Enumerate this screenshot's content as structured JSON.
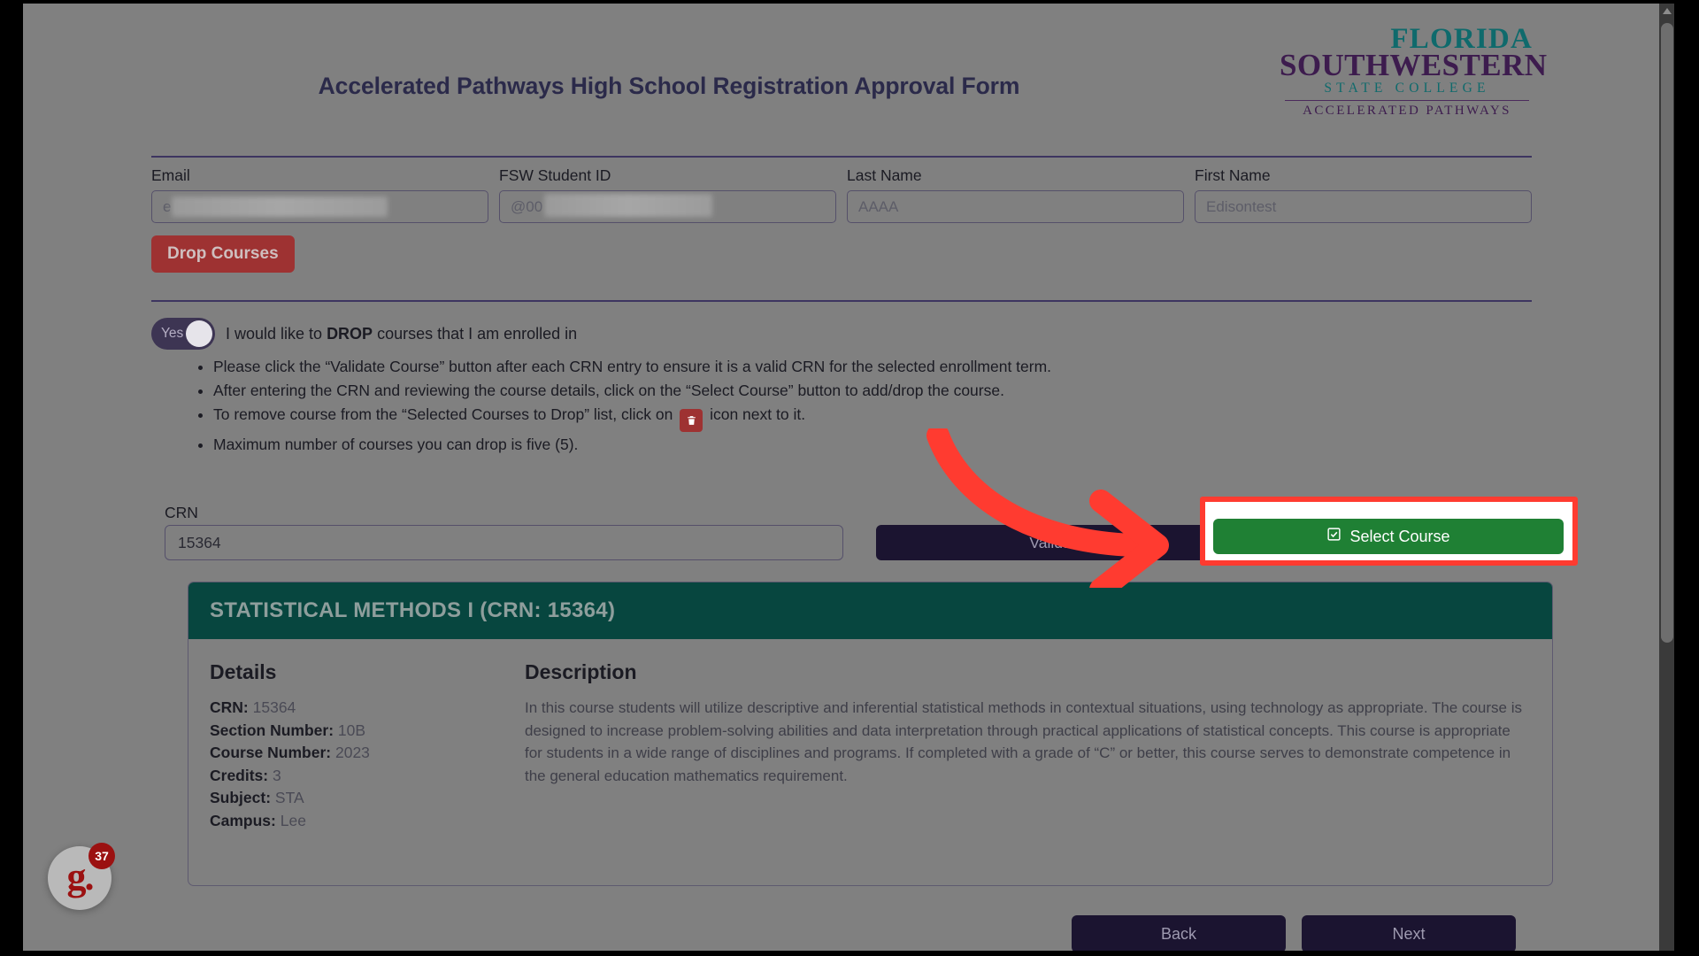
{
  "page": {
    "title": "Accelerated Pathways High School Registration Approval Form"
  },
  "logo": {
    "line1": "FLORIDA",
    "line2": "SOUTHWESTERN",
    "line3": "STATE COLLEGE",
    "line4": "ACCELERATED PATHWAYS",
    "teal": "#0f6a6c",
    "purple": "#3d1c4e"
  },
  "fields": [
    {
      "label": "Email",
      "value": "e",
      "redacted": true
    },
    {
      "label": "FSW Student ID",
      "value": "@00",
      "redacted": true
    },
    {
      "label": "Last Name",
      "value": "AAAA",
      "redacted": false
    },
    {
      "label": "First Name",
      "value": "Edisontest",
      "redacted": false
    }
  ],
  "section": {
    "drop_courses_label": "Drop Courses",
    "drop_courses_color": "#9e3232"
  },
  "toggle": {
    "state_label": "Yes",
    "description_prefix": "I would like to ",
    "description_emphasis": "DROP",
    "description_suffix": " courses that I am enrolled in"
  },
  "instructions": [
    "Please click the “Validate Course” button after each CRN entry to ensure it is a valid CRN for the selected enrollment term.",
    "After entering the CRN and reviewing the course details, click on the “Select Course” button to add/drop the course.",
    "To remove course from the “Selected Courses to Drop” list, click on ",
    "Maximum number of courses you can drop is five (5)."
  ],
  "instruction_3_suffix": " icon next to it.",
  "crn": {
    "label": "CRN",
    "value": "15364"
  },
  "actions": {
    "validate_label": "Validate Course",
    "select_label": "Select Course",
    "select_color": "#1f8034",
    "highlight_color": "#ff3b30"
  },
  "course_card": {
    "header": "STATISTICAL METHODS I  (CRN: 15364)",
    "header_color": "#07463f",
    "details_heading": "Details",
    "details": [
      {
        "label": "CRN:",
        "value": "15364"
      },
      {
        "label": "Section Number:",
        "value": "10B"
      },
      {
        "label": "Course Number:",
        "value": "2023"
      },
      {
        "label": "Credits:",
        "value": "3"
      },
      {
        "label": "Subject:",
        "value": "STA"
      },
      {
        "label": "Campus:",
        "value": "Lee"
      }
    ],
    "description_heading": "Description",
    "description": "In this course students will utilize descriptive and inferential statistical methods in contextual situations, using technology as appropriate. The course is designed to increase problem-solving abilities and data interpretation through practical applications of statistical concepts. This course is appropriate for students in a wide range of disciplines and programs. If completed with a grade of “C” or better, this course serves to demonstrate competence in the general education mathematics requirement."
  },
  "nav": {
    "back_label": "Back",
    "next_label": "Next"
  },
  "grammarly": {
    "logo_text": "g.",
    "count": "37"
  }
}
